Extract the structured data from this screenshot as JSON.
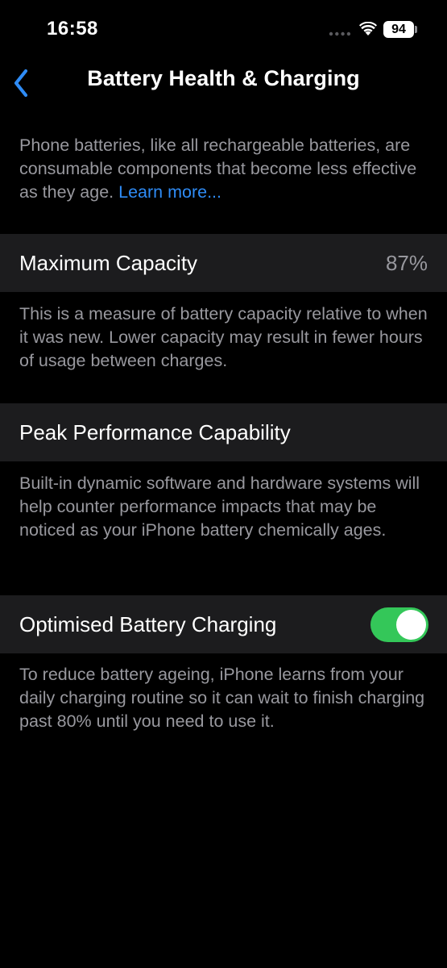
{
  "status_bar": {
    "time": "16:58",
    "battery_level": "94",
    "icons": [
      "signal-icon",
      "wifi-icon",
      "battery-icon"
    ]
  },
  "nav": {
    "title": "Battery Health & Charging",
    "back_icon": "chevron-left-icon"
  },
  "intro": {
    "text": "Phone batteries, like all rechargeable batteries, are consumable components that become less effective as they age. ",
    "link": "Learn more..."
  },
  "max_capacity": {
    "label": "Maximum Capacity",
    "value": "87%",
    "footer": "This is a measure of battery capacity relative to when it was new. Lower capacity may result in fewer hours of usage between charges."
  },
  "peak_performance": {
    "label": "Peak Performance Capability",
    "footer": "Built-in dynamic software and hardware systems will help counter performance impacts that may be noticed as your iPhone battery chemically ages."
  },
  "optimised_charging": {
    "label": "Optimised Battery Charging",
    "enabled": true,
    "footer": "To reduce battery ageing, iPhone learns from your daily charging routine so it can wait to finish charging past 80% until you need to use it."
  },
  "colors": {
    "background": "#000000",
    "cell": "#1c1c1e",
    "secondary_text": "#98989e",
    "accent": "#2f8cf6",
    "toggle_on": "#34c759"
  }
}
